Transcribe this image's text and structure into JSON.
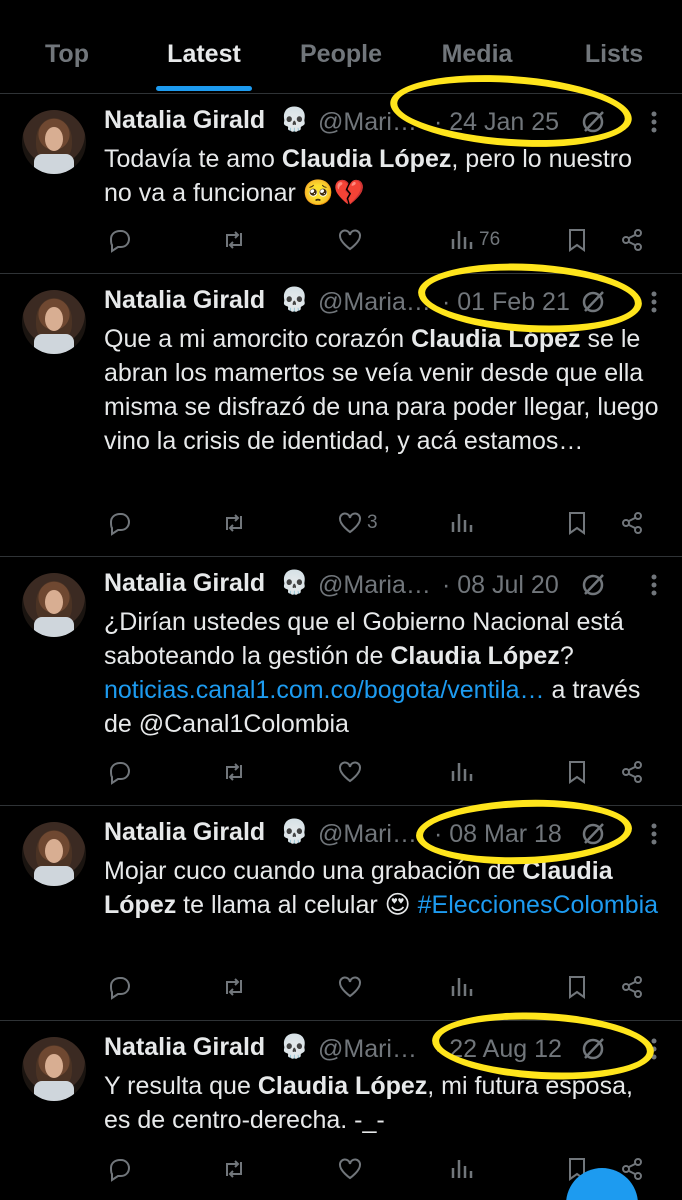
{
  "tabs": [
    {
      "label": "Top",
      "active": false
    },
    {
      "label": "Latest",
      "active": true
    },
    {
      "label": "People",
      "active": false
    },
    {
      "label": "Media",
      "active": false
    },
    {
      "label": "Lists",
      "active": false
    }
  ],
  "colors": {
    "accent": "#1d9bf0",
    "muted": "#71767b",
    "highlight": "#ffe51c"
  },
  "tweets": [
    {
      "name": "Natalia Girald",
      "name_emoji": "💀",
      "handle": "@Mari…",
      "date": "· 24 Jan 25",
      "text": [
        {
          "t": "Todavía te amo "
        },
        {
          "t": "Claudia López",
          "b": true
        },
        {
          "t": ", pero lo nuestro no va a funcionar 🥺💔"
        }
      ],
      "stats": {
        "replies": "",
        "retweets": "",
        "likes": "",
        "views": "76"
      }
    },
    {
      "name": "Natalia Girald",
      "name_emoji": "💀",
      "handle": "@Maria…",
      "date": "· 01 Feb 21",
      "text": [
        {
          "t": "Que a mi amorcito corazón "
        },
        {
          "t": "Claudia López",
          "b": true
        },
        {
          "t": " se le abran los mamertos se veía venir desde que ella misma se disfrazó de una para poder llegar, luego vino la crisis de identidad, y acá estamos…"
        }
      ],
      "stats": {
        "replies": "",
        "retweets": "",
        "likes": "3",
        "views": ""
      }
    },
    {
      "name": "Natalia Girald",
      "name_emoji": "💀",
      "handle": "@Maria…",
      "date": "· 08 Jul 20",
      "text": [
        {
          "t": "¿Dirían ustedes que el Gobierno Nacional está saboteando la gestión de "
        },
        {
          "t": "Claudia López",
          "b": true
        },
        {
          "t": "? "
        },
        {
          "t": "noticias.canal1.com.co/bogota/ventila…",
          "link": true
        },
        {
          "t": " a través de @Canal1Colombia"
        }
      ],
      "stats": {
        "replies": "",
        "retweets": "",
        "likes": "",
        "views": ""
      }
    },
    {
      "name": "Natalia Girald",
      "name_emoji": "💀",
      "handle": "@Mari…",
      "date": "· 08 Mar 18",
      "text": [
        {
          "t": "Mojar cuco cuando una grabación de "
        },
        {
          "t": "Claudia López",
          "b": true
        },
        {
          "t": " te llama al celular 😍 "
        },
        {
          "t": "#EleccionesColombia",
          "link": true
        }
      ],
      "stats": {
        "replies": "",
        "retweets": "",
        "likes": "",
        "views": ""
      }
    },
    {
      "name": "Natalia Girald",
      "name_emoji": "💀",
      "handle": "@Mari…",
      "date": "· 22 Aug 12",
      "text": [
        {
          "t": "Y resulta que "
        },
        {
          "t": "Claudia López",
          "b": true
        },
        {
          "t": ", mi futura esposa, es de centro-derecha. -_-"
        }
      ],
      "stats": {
        "replies": "",
        "retweets": "",
        "likes": "",
        "views": ""
      }
    }
  ]
}
